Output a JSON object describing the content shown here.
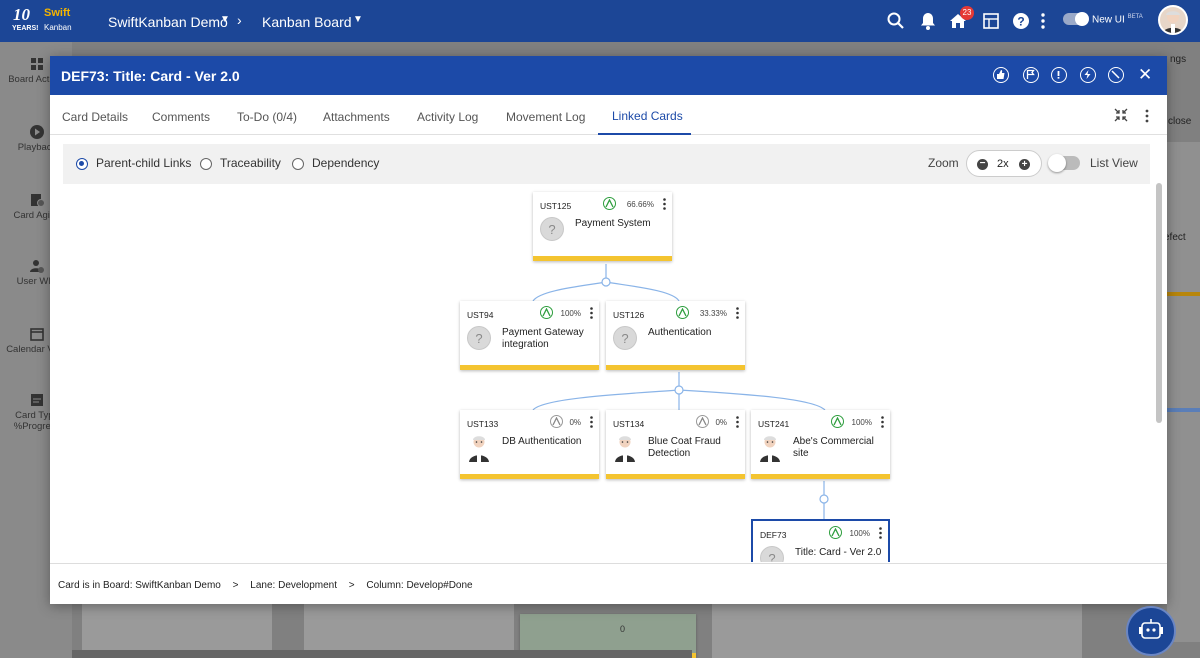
{
  "topbar": {
    "logo_ten": "10",
    "logo_years": "YEARS!",
    "logo_swift": "Swift",
    "logo_kanban": "Kanban",
    "board_name": "SwiftKanban Demo",
    "view_name": "Kanban Board",
    "notification_count": "23",
    "new_ui_label": "New UI",
    "new_ui_beta": "BETA"
  },
  "leftnav": {
    "items": [
      {
        "label": "Board Activity",
        "icon": "board-activity-icon"
      },
      {
        "label": "Playback",
        "icon": "play-icon"
      },
      {
        "label": "Card Aging",
        "icon": "card-aging-icon"
      },
      {
        "label": "User WIP",
        "icon": "user-wip-icon"
      },
      {
        "label": "Calendar View",
        "icon": "calendar-icon"
      },
      {
        "label": "Card Type %Progress",
        "icon": "card-type-icon"
      }
    ]
  },
  "background": {
    "right_text_1": "close",
    "right_text_2": "efect",
    "right_text_3": "ngs",
    "card_count": "0"
  },
  "modal": {
    "title": "DEF73:  Title: Card - Ver 2.0",
    "header_icons": [
      "thumbs-up-icon",
      "flag-icon",
      "alert-icon",
      "bolt-icon",
      "block-icon"
    ],
    "tabs": [
      {
        "label": "Card Details",
        "active": false
      },
      {
        "label": "Comments",
        "active": false
      },
      {
        "label": "To-Do (0/4)",
        "active": false
      },
      {
        "label": "Attachments",
        "active": false
      },
      {
        "label": "Activity Log",
        "active": false
      },
      {
        "label": "Movement Log",
        "active": false
      },
      {
        "label": "Linked Cards",
        "active": true
      }
    ],
    "link_types": [
      {
        "label": "Parent-child Links",
        "selected": true
      },
      {
        "label": "Traceability",
        "selected": false
      },
      {
        "label": "Dependency",
        "selected": false
      }
    ],
    "zoom_label": "Zoom",
    "zoom_value": "2x",
    "list_view_label": "List View",
    "footer": {
      "prefix": "Card is in Board:",
      "board": "SwiftKanban Demo",
      "lane_prefix": "Lane:",
      "lane": "Development",
      "column_prefix": "Column:",
      "column": "Develop#Done",
      "separator": ">"
    }
  },
  "cards": [
    {
      "id": "UST125",
      "percent": "66.66%",
      "title": "Payment System",
      "avatar": "unknown",
      "progress": 0.6666
    },
    {
      "id": "UST94",
      "percent": "100%",
      "title": "Payment Gateway integration",
      "avatar": "unknown",
      "progress": 1.0
    },
    {
      "id": "UST126",
      "percent": "33.33%",
      "title": "Authentication",
      "avatar": "unknown",
      "progress": 0.3333
    },
    {
      "id": "UST133",
      "percent": "0%",
      "title": "DB Authentication",
      "avatar": "person",
      "progress": 0
    },
    {
      "id": "UST134",
      "percent": "0%",
      "title": "Blue Coat Fraud Detection",
      "avatar": "person",
      "progress": 0
    },
    {
      "id": "UST241",
      "percent": "100%",
      "title": "Abe's Commercial site",
      "avatar": "person",
      "progress": 1.0
    },
    {
      "id": "DEF73",
      "percent": "100%",
      "title": "Title: Card - Ver 2.0",
      "avatar": "unknown",
      "progress": 1.0
    }
  ],
  "colors": {
    "header_blue": "#1c4aa8",
    "card_bar_yellow": "#f4c430",
    "progress_green": "#2e9e3e",
    "connector_blue": "#8ab4e8"
  }
}
